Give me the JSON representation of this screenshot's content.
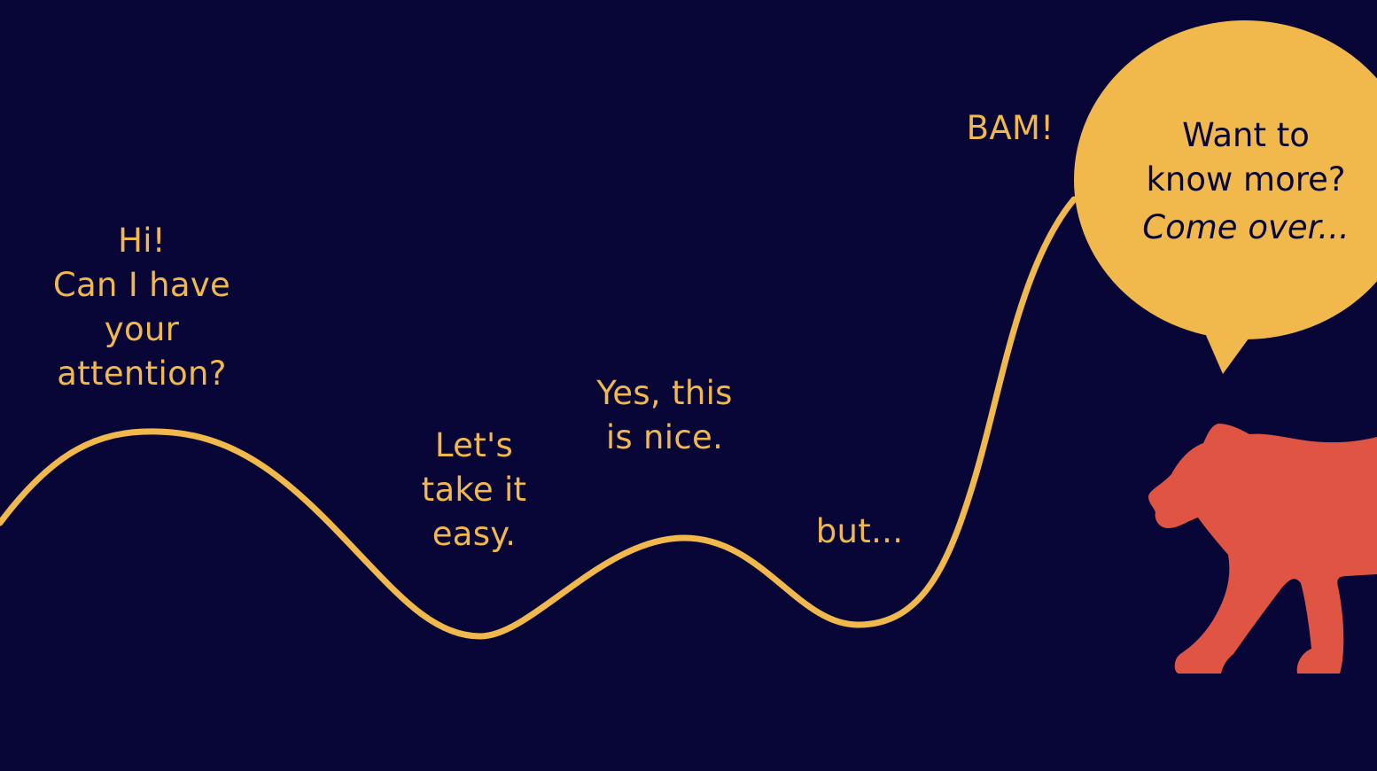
{
  "colors": {
    "background": "#080636",
    "accent": "#f1b84c",
    "tiger": "#e05444",
    "bubble_text": "#080636"
  },
  "labels": {
    "hi": [
      "Hi!",
      "Can I have",
      "your",
      "attention?"
    ],
    "easy": [
      "Let's",
      "take it",
      "easy."
    ],
    "nice": [
      "Yes, this",
      "is nice."
    ],
    "but": "but...",
    "bam": "BAM!"
  },
  "bubble": {
    "line1": "Want to",
    "line2": "know more?",
    "line3": "Come over..."
  },
  "icons": {
    "curve": "wave-curve",
    "bubble": "speech-bubble",
    "animal": "tiger-icon"
  }
}
